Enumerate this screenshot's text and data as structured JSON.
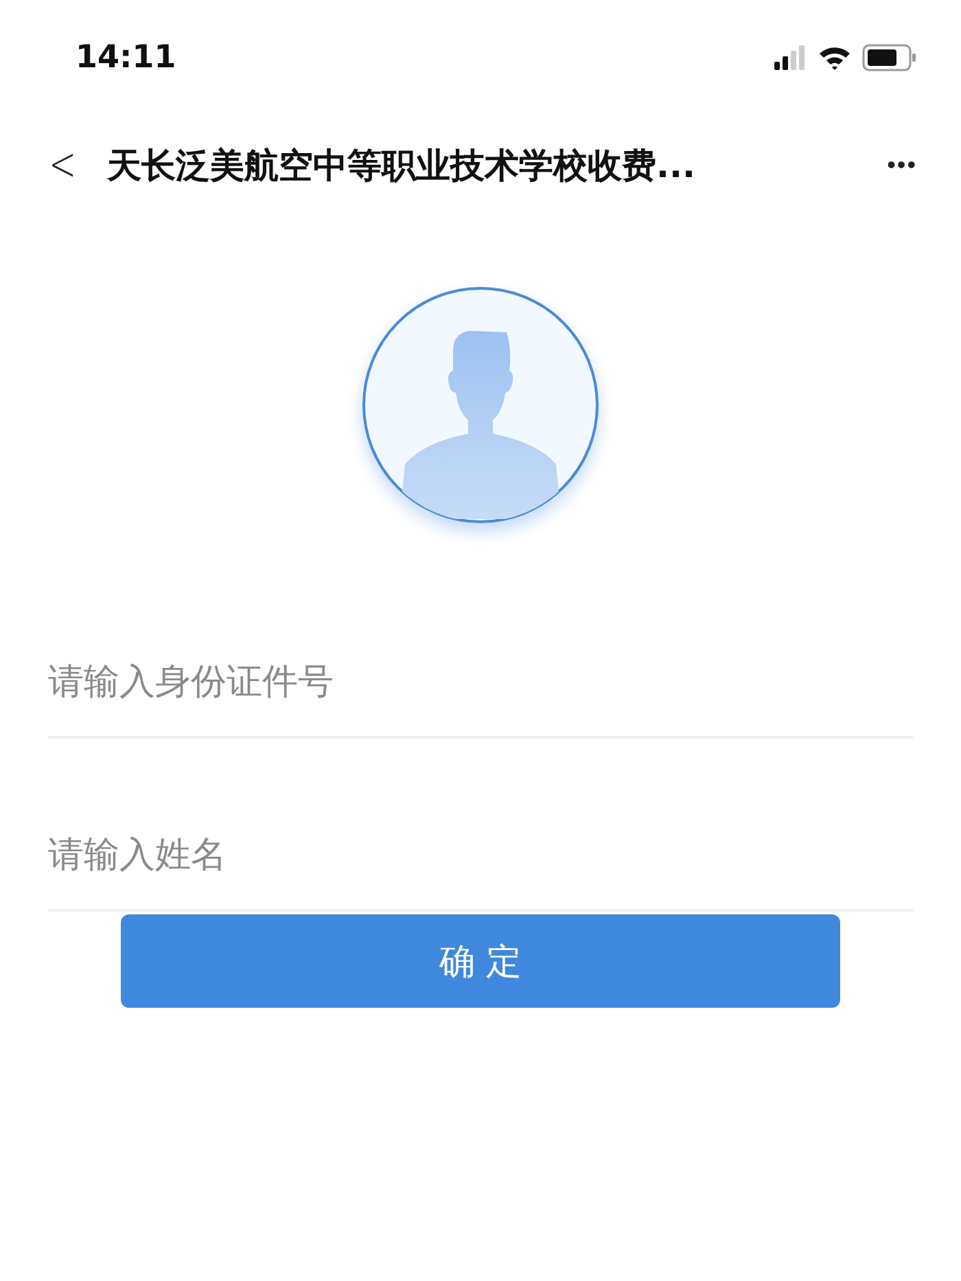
{
  "status_bar": {
    "time": "14:11"
  },
  "nav": {
    "back": "<",
    "title": "天长泛美航空中等职业技术学校收费...",
    "more": "•••"
  },
  "form": {
    "fields": [
      {
        "placeholder": "请输入身份证件号"
      },
      {
        "placeholder": "请输入姓名"
      }
    ],
    "submit": "确 定"
  }
}
